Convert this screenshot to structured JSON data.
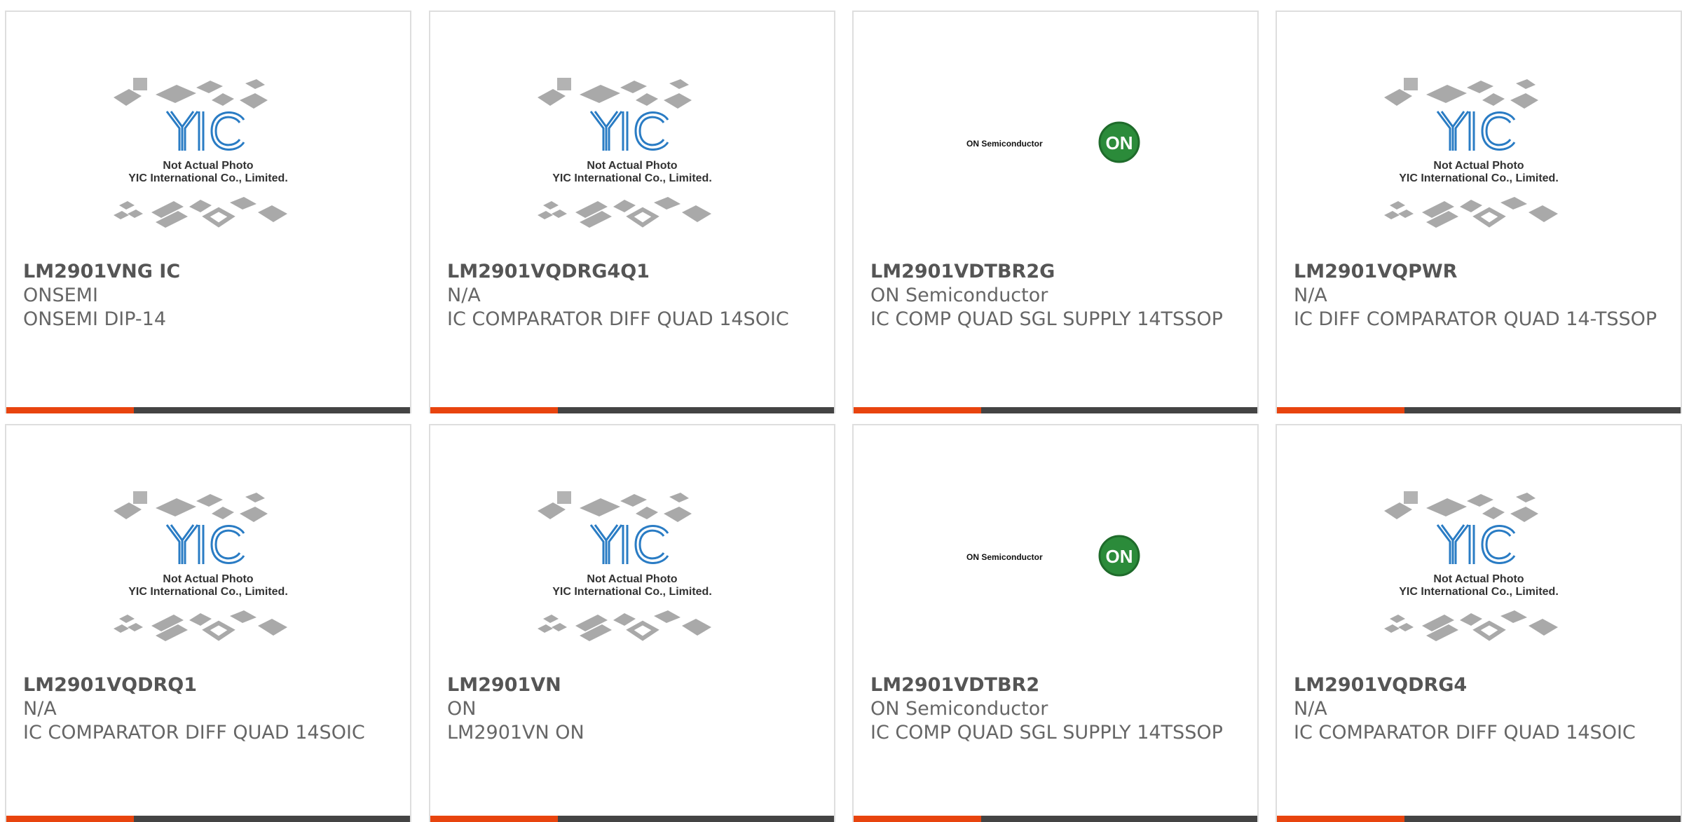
{
  "theme": {
    "accent": "#e8440e",
    "bar": "#444444",
    "text": "#666666"
  },
  "placeholder": {
    "line1": "Not Actual Photo",
    "line2": "YIC International Co., Limited.",
    "logo_text": "YIC"
  },
  "onsemi_logo": {
    "wordmark": "ON Semiconductor",
    "mark": "ON"
  },
  "products": [
    {
      "part": "LM2901VNG IC",
      "brand": "ONSEMI",
      "desc": "ONSEMI DIP-14",
      "image": "yic-placeholder"
    },
    {
      "part": "LM2901VQDRG4Q1",
      "brand": "N/A",
      "desc": "IC COMPARATOR DIFF QUAD 14SOIC",
      "image": "yic-placeholder"
    },
    {
      "part": "LM2901VDTBR2G",
      "brand": "ON Semiconductor",
      "desc": "IC COMP QUAD SGL SUPPLY 14TSSOP",
      "image": "onsemi-logo"
    },
    {
      "part": "LM2901VQPWR",
      "brand": "N/A",
      "desc": "IC DIFF COMPARATOR QUAD 14-TSSOP",
      "image": "yic-placeholder"
    },
    {
      "part": "LM2901VQDRQ1",
      "brand": "N/A",
      "desc": "IC COMPARATOR DIFF QUAD 14SOIC",
      "image": "yic-placeholder"
    },
    {
      "part": "LM2901VN",
      "brand": "ON",
      "desc": "LM2901VN ON",
      "image": "yic-placeholder"
    },
    {
      "part": "LM2901VDTBR2",
      "brand": "ON Semiconductor",
      "desc": "IC COMP QUAD SGL SUPPLY 14TSSOP",
      "image": "onsemi-logo"
    },
    {
      "part": "LM2901VQDRG4",
      "brand": "N/A",
      "desc": "IC COMPARATOR DIFF QUAD 14SOIC",
      "image": "yic-placeholder"
    }
  ]
}
